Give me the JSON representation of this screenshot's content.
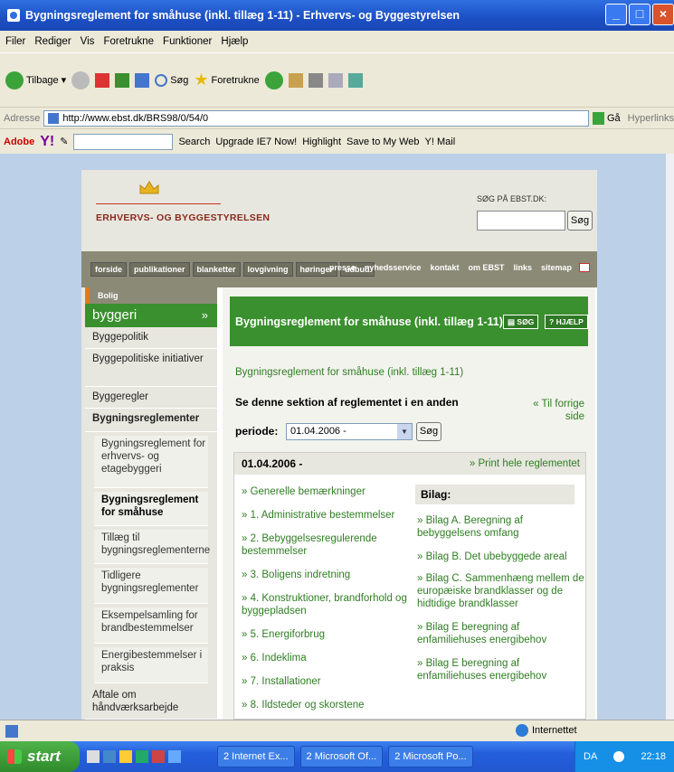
{
  "window": {
    "title": "Bygningsreglement for småhuse (inkl. tillæg 1-11) - Erhvervs- og Byggestyrelsen"
  },
  "menu": [
    "Filer",
    "Rediger",
    "Vis",
    "Foretrukne",
    "Funktioner",
    "Hjælp"
  ],
  "toolbar": {
    "back": "Tilbage",
    "search": "Søg",
    "favorites": "Foretrukne"
  },
  "address": {
    "label": "Adresse",
    "url": "http://www.ebst.dk/BRS98/0/54/0",
    "go": "Gå",
    "links": "Hyperlinks"
  },
  "yahoo": {
    "adobe": "Adobe",
    "search": "Search",
    "upgrade": "Upgrade IE7 Now!",
    "highlight": "Highlight",
    "save": "Save to My Web",
    "mail": "Y! Mail"
  },
  "site": {
    "logo": "ERHVERVS- OG BYGGESTYRELSEN",
    "search_label": "SØG PÅ EBST.DK:",
    "search_button": "Søg",
    "nav_buttons": [
      "forside",
      "publikationer",
      "blanketter",
      "lovgivning",
      "høringer",
      "udbud"
    ],
    "nav_links": [
      "presse",
      "nyhedsservice",
      "kontakt",
      "om EBST",
      "links",
      "sitemap"
    ]
  },
  "sidebar": {
    "tag": "Bolig",
    "section": "byggeri",
    "section_arrow": "»",
    "items": [
      "Byggepolitik",
      "Byggepolitiske initiativer",
      "Byggeregler",
      "Bygningsreglementer"
    ],
    "subitems": [
      "Bygningsreglement for erhvervs- og etagebyggeri",
      "Bygningsreglement for småhuse",
      "Tillæg til bygningsreglementerne",
      "Tidligere bygningsreglementer",
      "Eksempelsamling for brandbestemmelser",
      "Energibestemmelser i praksis"
    ],
    "last_item": "Aftale om håndværksarbejde"
  },
  "main": {
    "heading": "Bygningsreglement for småhuse (inkl. tillæg 1-11)",
    "sog_button": "SØG",
    "help_button": "HJÆLP",
    "subtitle": "Bygningsreglement for småhuse (inkl. tillæg 1-11)",
    "section_text": "Se denne sektion af reglementet i en anden",
    "period_label": "periode:",
    "period_value": "01.04.2006 -",
    "period_button": "Søg",
    "back_link": "« Til forrige side",
    "box_date": "01.04.2006 -",
    "print_link": "» Print hele reglementet",
    "sections": [
      "» Generelle bemærkninger",
      "» 1. Administrative bestemmelser",
      "» 2. Bebyggelsesregulerende bestemmelser",
      "» 3. Boligens indretning",
      "» 4. Konstruktioner, brandforhold og byggepladsen",
      "» 5. Energiforbrug",
      "» 6. Indeklima",
      "» 7. Installationer",
      "» 8. Ildsteder og skorstene"
    ],
    "bilag_head": "Bilag:",
    "bilag": [
      "» Bilag A. Beregning af bebyggelsens omfang",
      "» Bilag B. Det ubebyggede areal",
      "» Bilag C. Sammenhæng mellem de europæiske brandklasser og de hidtidige brandklasser",
      "» Bilag E beregning af enfamiliehuses energibehov",
      "» Bilag E beregning af enfamiliehuses energibehov"
    ]
  },
  "status": {
    "zone": "Internettet"
  },
  "taskbar": {
    "start": "start",
    "tasks": [
      "2 Internet Ex...",
      "2 Microsoft Of...",
      "2 Microsoft Po..."
    ],
    "lang": "DA",
    "clock": "22:18"
  }
}
